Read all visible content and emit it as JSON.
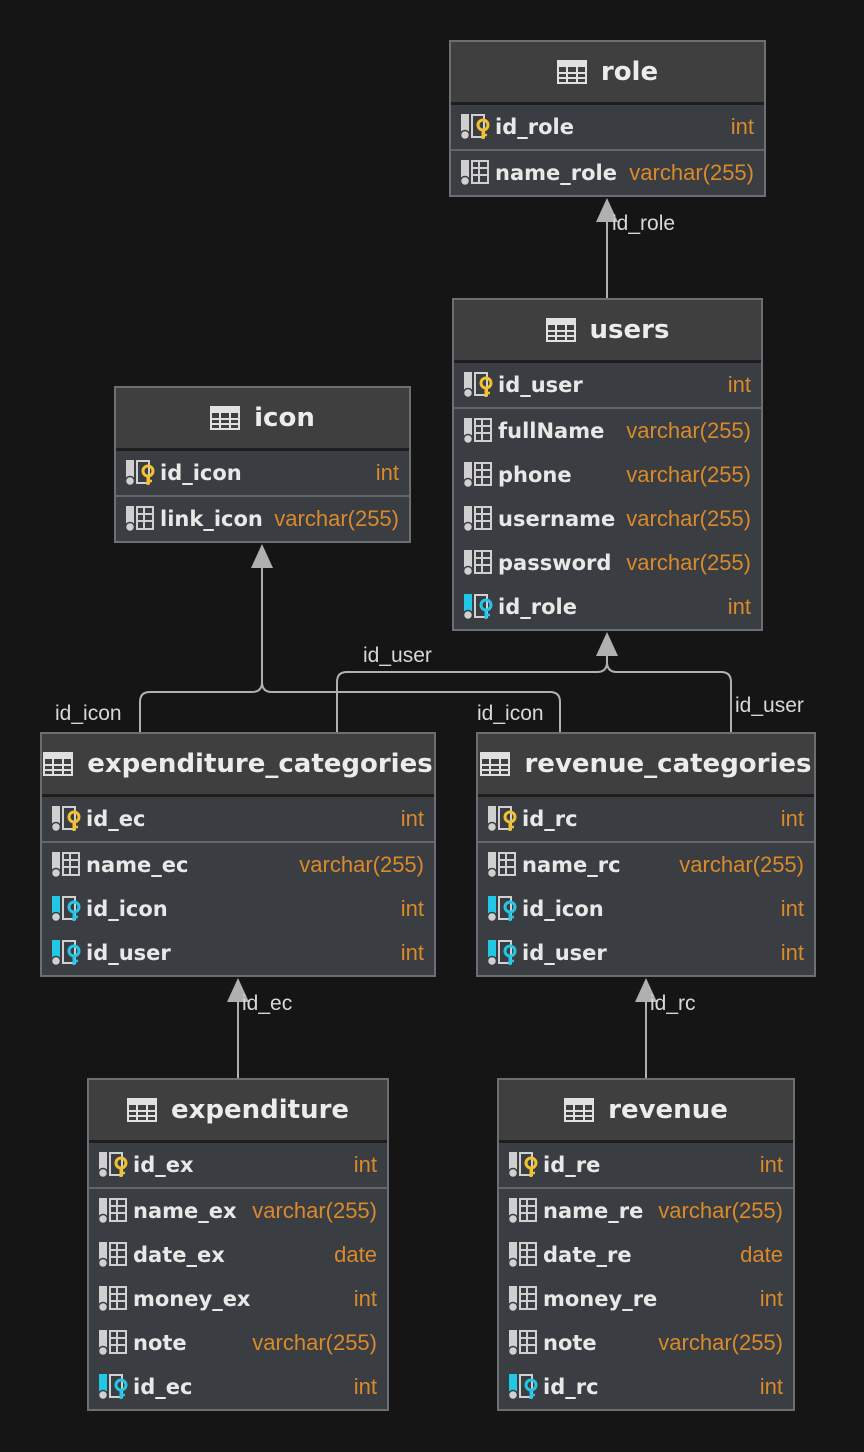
{
  "tables": {
    "role": {
      "title": "role",
      "pk": [
        {
          "name": "id_role",
          "type": "int",
          "kind": "pk"
        }
      ],
      "rows": [
        {
          "name": "name_role",
          "type": "varchar(255)",
          "kind": "col"
        }
      ]
    },
    "users": {
      "title": "users",
      "pk": [
        {
          "name": "id_user",
          "type": "int",
          "kind": "pk"
        }
      ],
      "rows": [
        {
          "name": "fullName",
          "type": "varchar(255)",
          "kind": "col"
        },
        {
          "name": "phone",
          "type": "varchar(255)",
          "kind": "col"
        },
        {
          "name": "username",
          "type": "varchar(255)",
          "kind": "col"
        },
        {
          "name": "password",
          "type": "varchar(255)",
          "kind": "col"
        },
        {
          "name": "id_role",
          "type": "int",
          "kind": "fk"
        }
      ]
    },
    "icon": {
      "title": "icon",
      "pk": [
        {
          "name": "id_icon",
          "type": "int",
          "kind": "pk"
        }
      ],
      "rows": [
        {
          "name": "link_icon",
          "type": "varchar(255)",
          "kind": "col"
        }
      ]
    },
    "expenditure_categories": {
      "title": "expenditure_categories",
      "pk": [
        {
          "name": "id_ec",
          "type": "int",
          "kind": "pk"
        }
      ],
      "rows": [
        {
          "name": "name_ec",
          "type": "varchar(255)",
          "kind": "col"
        },
        {
          "name": "id_icon",
          "type": "int",
          "kind": "fk"
        },
        {
          "name": "id_user",
          "type": "int",
          "kind": "fk"
        }
      ]
    },
    "revenue_categories": {
      "title": "revenue_categories",
      "pk": [
        {
          "name": "id_rc",
          "type": "int",
          "kind": "pk"
        }
      ],
      "rows": [
        {
          "name": "name_rc",
          "type": "varchar(255)",
          "kind": "col"
        },
        {
          "name": "id_icon",
          "type": "int",
          "kind": "fk"
        },
        {
          "name": "id_user",
          "type": "int",
          "kind": "fk"
        }
      ]
    },
    "expenditure": {
      "title": "expenditure",
      "pk": [
        {
          "name": "id_ex",
          "type": "int",
          "kind": "pk"
        }
      ],
      "rows": [
        {
          "name": "name_ex",
          "type": "varchar(255)",
          "kind": "col"
        },
        {
          "name": "date_ex",
          "type": "date",
          "kind": "col"
        },
        {
          "name": "money_ex",
          "type": "int",
          "kind": "col"
        },
        {
          "name": "note",
          "type": "varchar(255)",
          "kind": "col"
        },
        {
          "name": "id_ec",
          "type": "int",
          "kind": "fk"
        }
      ]
    },
    "revenue": {
      "title": "revenue",
      "pk": [
        {
          "name": "id_re",
          "type": "int",
          "kind": "pk"
        }
      ],
      "rows": [
        {
          "name": "name_re",
          "type": "varchar(255)",
          "kind": "col"
        },
        {
          "name": "date_re",
          "type": "date",
          "kind": "col"
        },
        {
          "name": "money_re",
          "type": "int",
          "kind": "col"
        },
        {
          "name": "note",
          "type": "varchar(255)",
          "kind": "col"
        },
        {
          "name": "id_rc",
          "type": "int",
          "kind": "fk"
        }
      ]
    }
  },
  "relations": {
    "users_role": "id_role",
    "ec_icon": "id_icon",
    "ec_users": "id_user",
    "rc_icon": "id_icon",
    "rc_users": "id_user",
    "ex_ec": "id_ec",
    "re_rc": "id_rc"
  },
  "colors": {
    "background": "#151515",
    "table_body": "#3a3d41",
    "table_header": "#3f3f3f",
    "type_text": "#d98a2b",
    "pk_key": "#f2c12e",
    "fk_key": "#22c7e8",
    "edge": "#b0b0b0"
  },
  "icons": {
    "table": "table-icon",
    "pk": "primary-key-icon",
    "fk": "foreign-key-icon",
    "column": "column-icon"
  }
}
